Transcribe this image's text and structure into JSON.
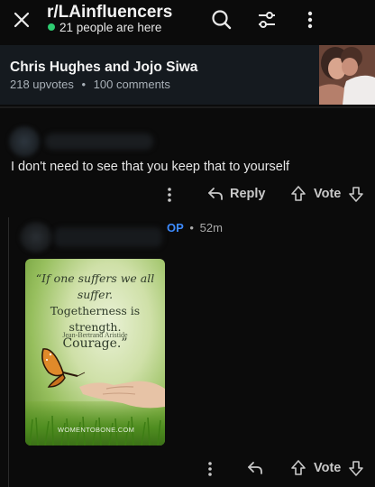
{
  "header": {
    "subreddit": "r/LAinfluencersn...",
    "online": "21 people are here",
    "close_icon": "close-icon",
    "search_icon": "search-icon",
    "filter_icon": "filter-icon",
    "more_icon": "more-vertical-icon"
  },
  "post": {
    "title": "Chris Hughes and Jojo Siwa",
    "upvotes": "218 upvotes",
    "separator": "•",
    "comments": "100 comments"
  },
  "comment1": {
    "text": "I don't need to see that you keep that to yourself",
    "reply_label": "Reply",
    "vote_label": "Vote"
  },
  "comment2": {
    "op_label": "OP",
    "separator": "•",
    "time": "52m",
    "vote_label": "Vote",
    "image": {
      "quote_line1": "“If one suffers we all suffer.",
      "quote_line2": "Togetherness is strength.",
      "quote_line3": "Courage.”",
      "author": "Jean-Bertrand Aristide",
      "watermark": "WOMENTOBONE.COM"
    }
  },
  "colors": {
    "background": "#0b0b0b",
    "online_dot": "#2ecc71",
    "op_accent": "#3d8bff",
    "post_card": "#151a1f"
  }
}
